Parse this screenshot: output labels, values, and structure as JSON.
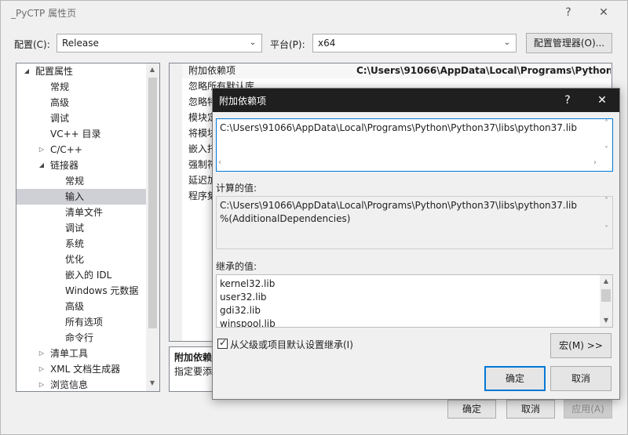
{
  "window": {
    "title": "_PyCTP 属性页",
    "help_label": "?",
    "close_label": "✕"
  },
  "config_bar": {
    "config_label": "配置(C):",
    "config_value": "Release",
    "platform_label": "平台(P):",
    "platform_value": "x64",
    "manager_button": "配置管理器(O)..."
  },
  "tree": {
    "items": [
      {
        "label": "配置属性",
        "expander": "◢"
      },
      {
        "label": "常规"
      },
      {
        "label": "高级"
      },
      {
        "label": "调试"
      },
      {
        "label": "VC++ 目录"
      },
      {
        "label": "C/C++",
        "expander": "▷"
      },
      {
        "label": "链接器",
        "expander": "◢"
      },
      {
        "label": "常规"
      },
      {
        "label": "输入"
      },
      {
        "label": "清单文件"
      },
      {
        "label": "调试"
      },
      {
        "label": "系统"
      },
      {
        "label": "优化"
      },
      {
        "label": "嵌入的 IDL"
      },
      {
        "label": "Windows 元数据"
      },
      {
        "label": "高级"
      },
      {
        "label": "所有选项"
      },
      {
        "label": "命令行"
      },
      {
        "label": "清单工具",
        "expander": "▷"
      },
      {
        "label": "XML 文档生成器",
        "expander": "▷"
      },
      {
        "label": "浏览信息",
        "expander": "▷"
      }
    ]
  },
  "properties": {
    "rows": [
      {
        "name": "附加依赖项",
        "value": "C:\\Users\\91066\\AppData\\Local\\Programs\\Python\\Py"
      },
      {
        "name": "忽略所有默认库",
        "value": ""
      },
      {
        "name": "忽略特",
        "value": ""
      },
      {
        "name": "模块定",
        "value": ""
      },
      {
        "name": "将模块",
        "value": ""
      },
      {
        "name": "嵌入托",
        "value": ""
      },
      {
        "name": "强制符",
        "value": ""
      },
      {
        "name": "延迟加",
        "value": ""
      },
      {
        "name": "程序集",
        "value": ""
      }
    ],
    "description_title": "附加依赖",
    "description_text": "指定要添"
  },
  "main_buttons": {
    "ok": "确定",
    "cancel": "取消",
    "apply": "应用(A)"
  },
  "dialog": {
    "title": "附加依赖项",
    "help_label": "?",
    "close_label": "✕",
    "input_value": "C:\\Users\\91066\\AppData\\Local\\Programs\\Python\\Python37\\libs\\python37.lib",
    "computed_label": "计算的值:",
    "computed_lines": [
      "C:\\Users\\91066\\AppData\\Local\\Programs\\Python\\Python37\\libs\\python37.lib",
      "%(AdditionalDependencies)"
    ],
    "inherited_label": "继承的值:",
    "inherited_lines": [
      "kernel32.lib",
      "user32.lib",
      "gdi32.lib",
      "winspool.lib"
    ],
    "inherit_checkbox_label": "从父级或项目默认设置继承(I)",
    "inherit_checked": true,
    "macro_button": "宏(M) >>",
    "ok": "确定",
    "cancel": "取消"
  }
}
